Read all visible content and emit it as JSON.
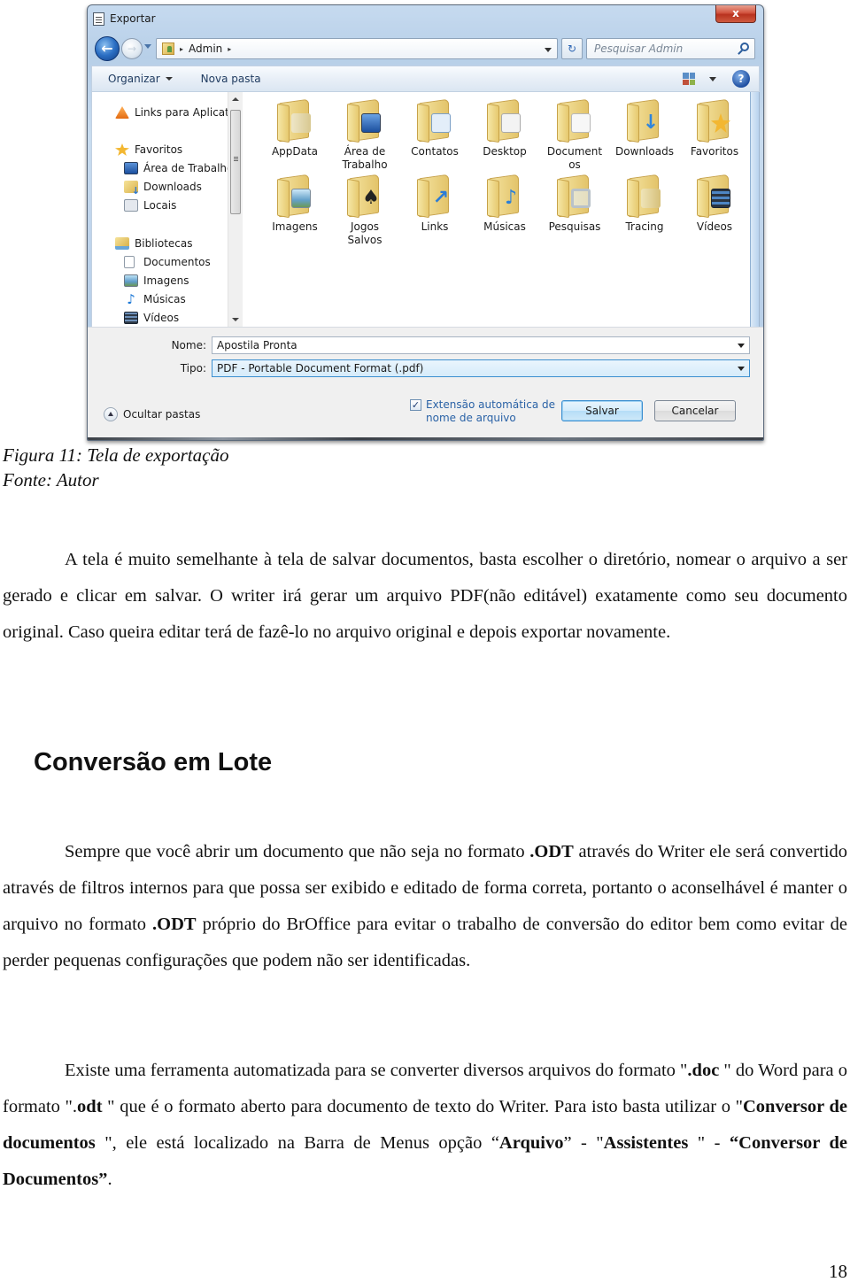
{
  "dialog": {
    "title": "Exportar",
    "close_label": "x",
    "nav": {
      "back_label": "←",
      "forward_label": "→",
      "breadcrumb": [
        "Admin"
      ],
      "breadcrumb_separator": "▸",
      "refresh_label": "↻",
      "search_placeholder": "Pesquisar Admin"
    },
    "toolbar": {
      "organize_label": "Organizar",
      "new_folder_label": "Nova pasta",
      "help_label": "?"
    },
    "sidebar": {
      "items": [
        {
          "label": "Links para Aplicativ",
          "icon": "vlc-icon"
        },
        {
          "label": "Favoritos",
          "icon": "star-icon"
        },
        {
          "label": "Área de Trabalho",
          "icon": "desktop-icon"
        },
        {
          "label": "Downloads",
          "icon": "downloads-icon"
        },
        {
          "label": "Locais",
          "icon": "recent-places-icon"
        },
        {
          "label": "Bibliotecas",
          "icon": "libraries-icon"
        },
        {
          "label": "Documentos",
          "icon": "documents-icon"
        },
        {
          "label": "Imagens",
          "icon": "pictures-icon"
        },
        {
          "label": "Músicas",
          "icon": "music-icon"
        },
        {
          "label": "Vídeos",
          "icon": "videos-icon"
        }
      ]
    },
    "files": [
      {
        "label": "AppData",
        "icon": "folder-icon"
      },
      {
        "label": "Área de Trabalho",
        "icon": "desktop-folder-icon"
      },
      {
        "label": "Contatos",
        "icon": "contacts-folder-icon"
      },
      {
        "label": "Desktop",
        "icon": "desktop-folder-icon"
      },
      {
        "label": "Documentos",
        "icon": "documents-folder-icon"
      },
      {
        "label": "Downloads",
        "icon": "downloads-folder-icon"
      },
      {
        "label": "Favoritos",
        "icon": "favorites-folder-icon"
      },
      {
        "label": "Imagens",
        "icon": "pictures-folder-icon"
      },
      {
        "label": "Jogos Salvos",
        "icon": "saved-games-folder-icon"
      },
      {
        "label": "Links",
        "icon": "links-folder-icon"
      },
      {
        "label": "Músicas",
        "icon": "music-folder-icon"
      },
      {
        "label": "Pesquisas",
        "icon": "searches-folder-icon"
      },
      {
        "label": "Tracing",
        "icon": "folder-icon"
      },
      {
        "label": "Vídeos",
        "icon": "videos-folder-icon"
      }
    ],
    "file_label_lines": [
      [
        "AppData"
      ],
      [
        "Área de",
        "Trabalho"
      ],
      [
        "Contatos"
      ],
      [
        "Desktop"
      ],
      [
        "Document",
        "os"
      ],
      [
        "Downloads"
      ],
      [
        "Favoritos"
      ],
      [
        "Imagens"
      ],
      [
        "Jogos",
        "Salvos"
      ],
      [
        "Links"
      ],
      [
        "Músicas"
      ],
      [
        "Pesquisas"
      ],
      [
        "Tracing"
      ],
      [
        "Vídeos"
      ]
    ],
    "name_label": "Nome:",
    "name_value": "Apostila Pronta",
    "type_label": "Tipo:",
    "type_value": "PDF - Portable Document Format (.pdf)",
    "auto_extension_line1": "Extensão automática de",
    "auto_extension_line2": "nome de arquivo",
    "auto_extension_checked": true,
    "hide_folders_label": "Ocultar pastas",
    "save_label": "Salvar",
    "cancel_label": "Cancelar"
  },
  "caption": {
    "figure": "Figura 11: Tela de exportação",
    "source": "Fonte: Autor"
  },
  "paragraph1": "A tela é muito semelhante à tela de salvar documentos, basta escolher o diretório, nomear o arquivo a ser gerado e clicar em salvar. O writer irá gerar um arquivo PDF(não editável) exatamente como seu documento original. Caso queira editar terá de fazê-lo no arquivo original e depois exportar novamente.",
  "heading": "Conversão em Lote",
  "paragraph2": {
    "part1": "Sempre que você abrir um documento que não seja no formato ",
    "bold1": ".ODT",
    "part2": " através do Writer ele será convertido através de filtros internos para que possa ser exibido e editado de forma correta, portanto o aconselhável é manter o arquivo no formato ",
    "bold2": ".ODT",
    "part3": " próprio do BrOffice para evitar o trabalho de conversão do editor bem como evitar de perder pequenas configurações que podem não ser identificadas."
  },
  "paragraph3": {
    "part1": "Existe uma ferramenta automatizada para se converter diversos arquivos do formato \"",
    "bold1": ".doc",
    "part2": " \" do Word para o formato \".",
    "bold2": "odt",
    "part3": " \" que é o formato aberto para documento de texto do Writer. Para isto basta utilizar o \"",
    "bold3": "Conversor de documentos",
    "part4": " \", ele está localizado na Barra de Menus opção “",
    "bold4": "Arquivo",
    "part5": "” - \"",
    "bold5": "Assistentes",
    "part6": " \" - ",
    "bold6": "“Conversor de Documentos”",
    "part7": "."
  },
  "page_number": "18"
}
